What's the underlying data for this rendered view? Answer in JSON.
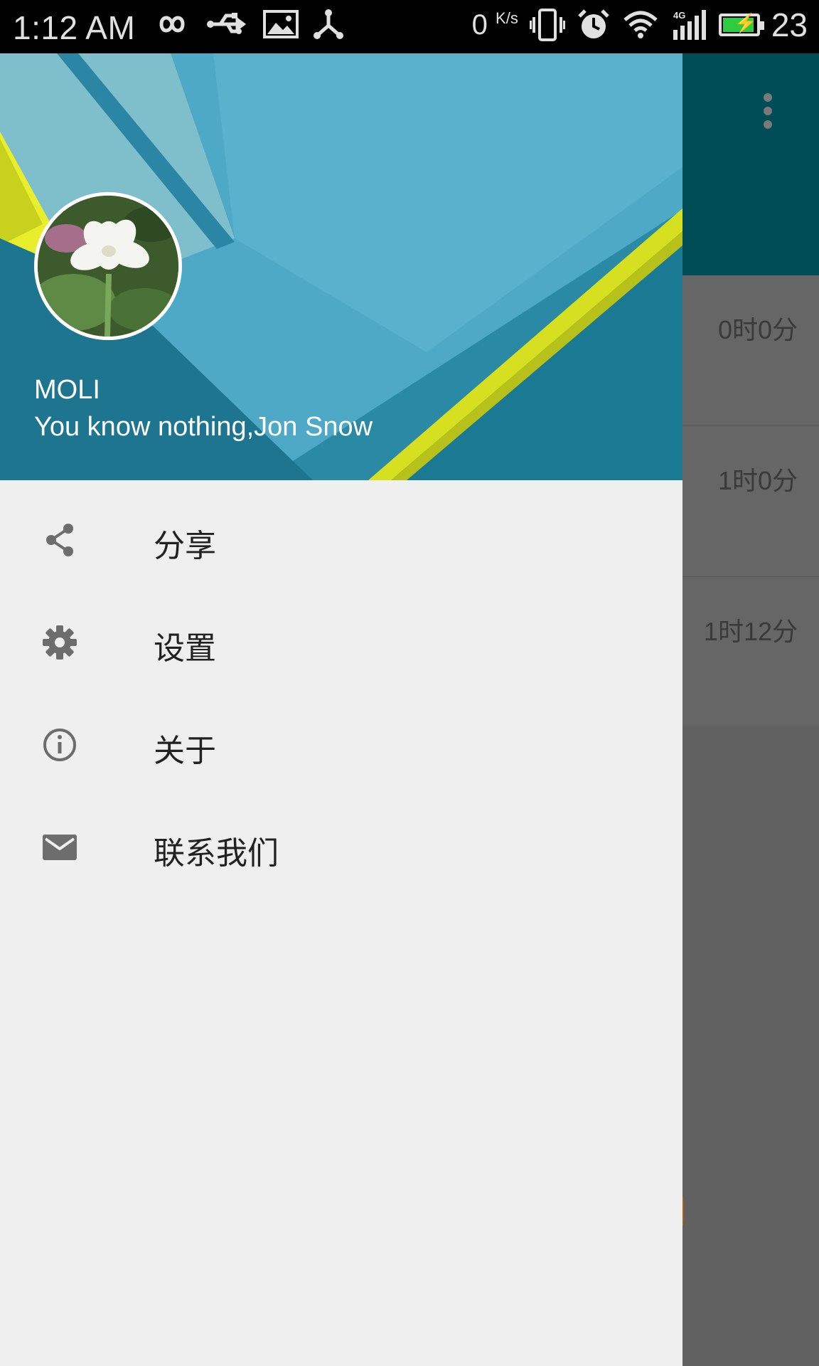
{
  "status_bar": {
    "time": "1:12 AM",
    "net_speed": "0",
    "net_speed_unit": "K/s",
    "battery_level": "23",
    "icons": [
      "infinity-icon",
      "usb-icon",
      "image-icon",
      "share-hub-icon",
      "vibrate-icon",
      "alarm-icon",
      "wifi-icon",
      "signal-4g-icon",
      "battery-charging-icon"
    ]
  },
  "background_app": {
    "durations": [
      "0时0分",
      "1时0分",
      "1时12分"
    ]
  },
  "drawer": {
    "header": {
      "name": "MOLI",
      "motto": "You know nothing,Jon Snow"
    },
    "menu": [
      {
        "label": "分享",
        "icon": "share-icon"
      },
      {
        "label": "设置",
        "icon": "settings-icon"
      },
      {
        "label": "关于",
        "icon": "info-icon"
      },
      {
        "label": "联系我们",
        "icon": "mail-icon"
      }
    ]
  },
  "colors": {
    "toolbar": "#004d57",
    "header_blue": "#4ea9c7",
    "accent_yellow": "#d6e021",
    "drawer_bg": "#efefef",
    "scrim": "#616161"
  }
}
